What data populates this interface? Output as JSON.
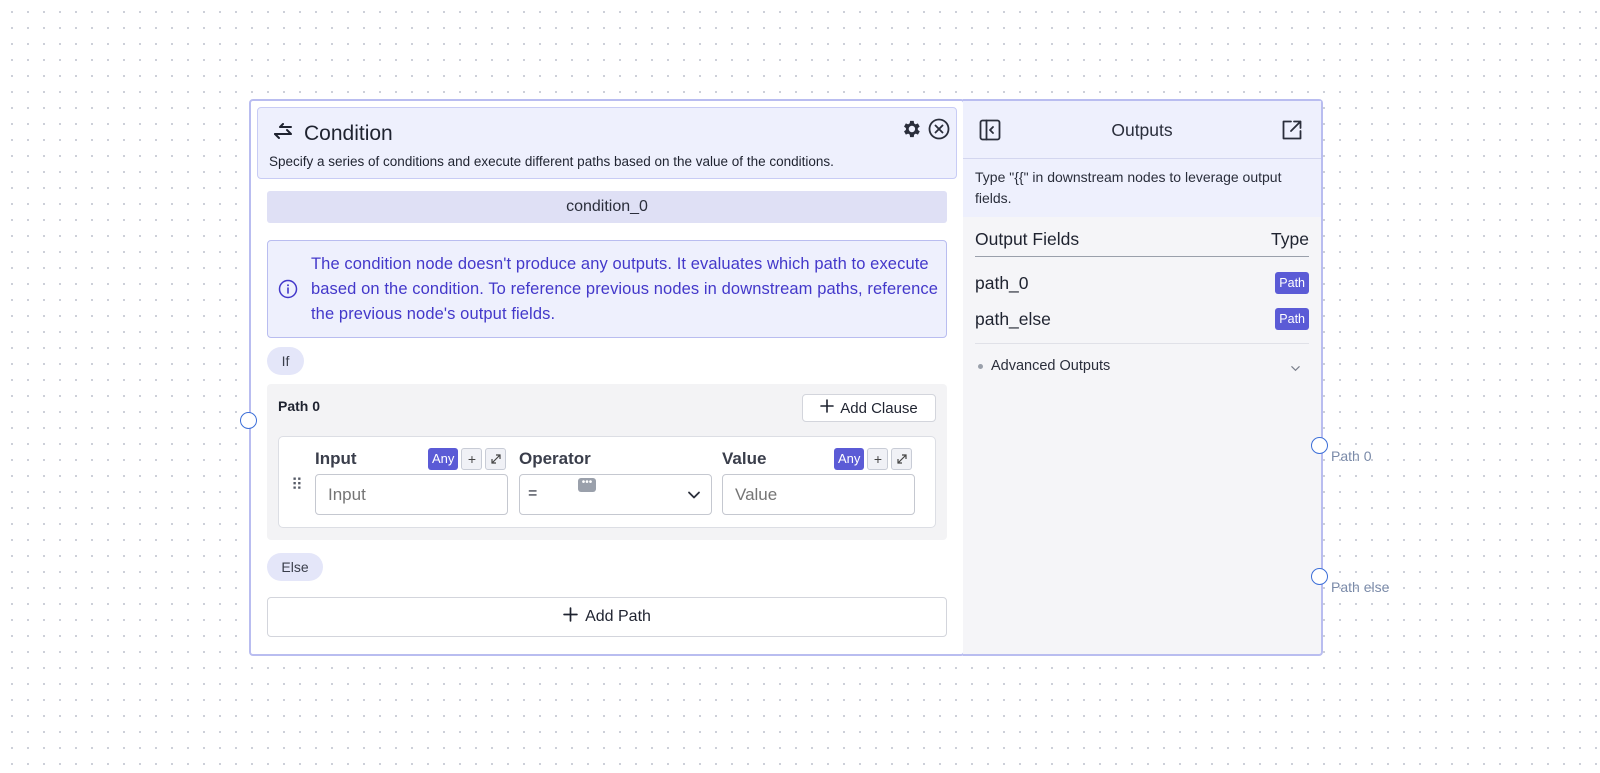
{
  "node": {
    "title": "Condition",
    "description": "Specify a series of conditions and execute different paths based on the value of the conditions.",
    "name": "condition_0",
    "info": "The condition node doesn't produce any outputs. It evaluates which path to execute based on the condition. To reference previous nodes in downstream paths, reference the previous node's output fields.",
    "if_label": "If",
    "else_label": "Else",
    "add_path_label": "Add Path",
    "path": {
      "title": "Path 0",
      "add_clause_label": "Add Clause",
      "clause": {
        "input_label": "Input",
        "input_placeholder": "Input",
        "operator_label": "Operator",
        "operator_value": "=",
        "value_label": "Value",
        "value_placeholder": "Value",
        "any_tag": "Any",
        "plus": "+"
      }
    }
  },
  "outputs": {
    "title": "Outputs",
    "note": "Type \"{{\" in downstream nodes to leverage output fields.",
    "col_fields": "Output Fields",
    "col_type": "Type",
    "rows": [
      {
        "name": "path_0",
        "type": "Path"
      },
      {
        "name": "path_else",
        "type": "Path"
      }
    ],
    "advanced_label": "Advanced Outputs"
  },
  "handles": {
    "path_0": "Path 0",
    "path_else": "Path else"
  },
  "icons": {
    "condition": "arrows-swap-icon",
    "settings": "gear-icon",
    "close": "close-circle-icon",
    "info": "info-icon",
    "collapse": "sidebar-collapse-icon",
    "open_external": "open-external-icon",
    "drag": "drag-handle-icon",
    "chevron": "chevron-down-icon"
  },
  "colors": {
    "accent": "#5b5bd6",
    "node_border": "#b9bdf0",
    "info_text": "#4338ca",
    "handle": "#3d6fd8"
  }
}
